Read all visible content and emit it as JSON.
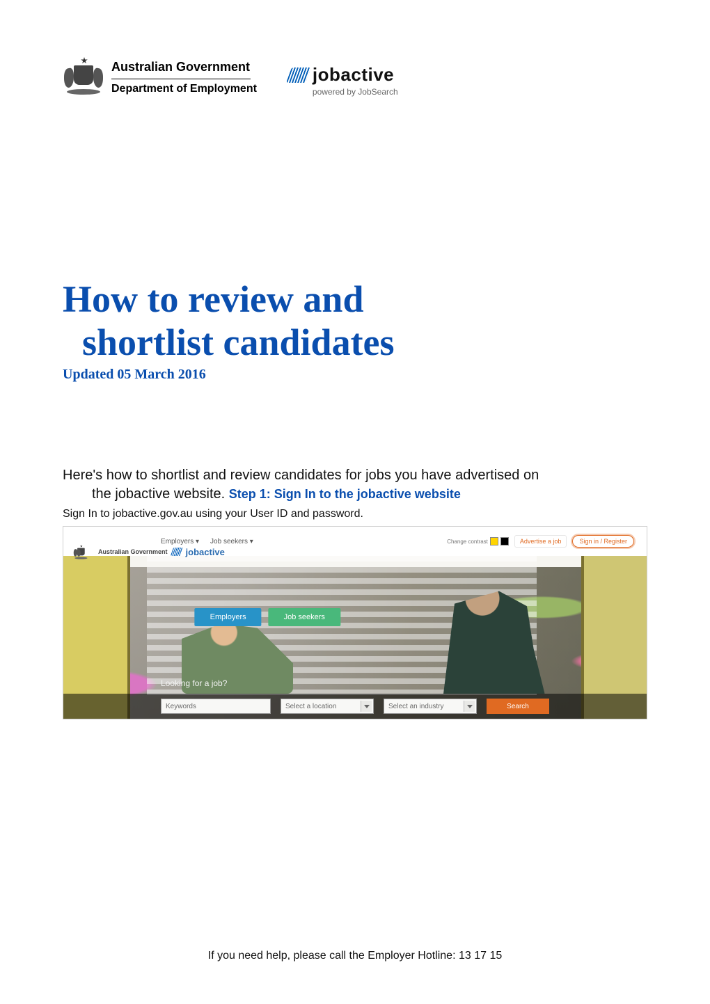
{
  "gov": {
    "top": "Australian Government",
    "bottom": "Department of Employment"
  },
  "jobactive": {
    "title": "jobactive",
    "subtitle": "powered by JobSearch"
  },
  "doc": {
    "title_line1": "How to review and",
    "title_line2": "shortlist candidates",
    "updated": "Updated 05 March 2016",
    "intro_line1": "Here's how to shortlist and review candidates for jobs you have advertised on",
    "intro_line2_prefix": "the jobactive website.  ",
    "step1_label": "Step 1: Sign In to the jobactive website",
    "signin_line": "Sign In to jobactive.gov.au using your User ID and password."
  },
  "shot": {
    "top_gov": "Australian Government",
    "ja_title": "jobactive",
    "nav_employers": "Employers ▾",
    "nav_jobseekers": "Job seekers ▾",
    "contrast_label": "Change contrast",
    "advertise": "Advertise a job",
    "signin": "Sign in / Register",
    "hero_employers": "Employers",
    "hero_jobseekers": "Job seekers",
    "looking": "Looking for a job?",
    "keywords": "Keywords",
    "location": "Select a location",
    "industry": "Select an industry",
    "search": "Search"
  },
  "footer": "If you need help, please call the Employer Hotline: 13 17 15"
}
